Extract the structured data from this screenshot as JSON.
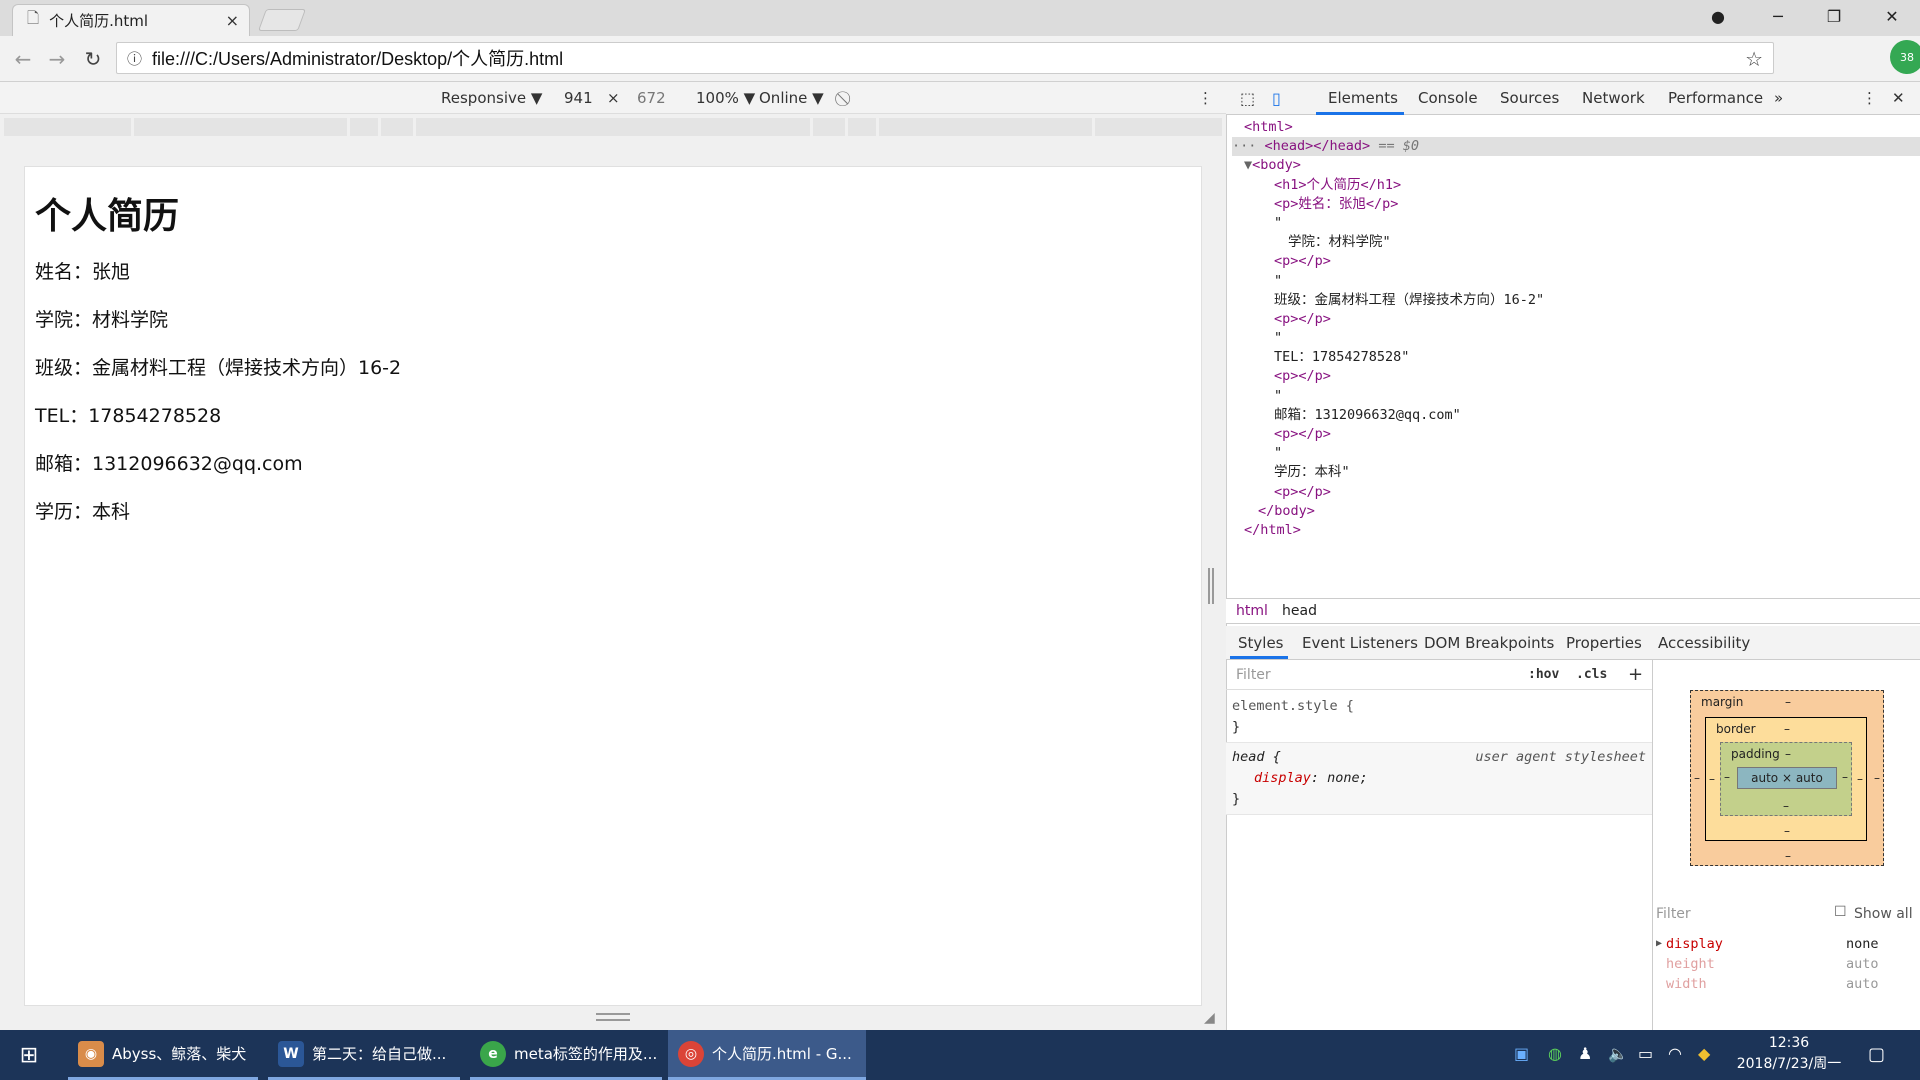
{
  "browser": {
    "tab_title": "个人简历.html",
    "tab_close": "×",
    "url": "file:///C:/Users/Administrator/Desktop/个人简历.html"
  },
  "device_toolbar": {
    "mode": "Responsive ▼",
    "width": "941",
    "times": "×",
    "height": "672",
    "zoom": "100% ▼",
    "network": "Online ▼"
  },
  "page": {
    "heading": "个人简历",
    "lines": [
      "姓名：张旭",
      "学院：材料学院",
      "班级：金属材料工程（焊接技术方向）16-2",
      "TEL：17854278528",
      "邮箱：1312096632@qq.com",
      "学历：本科"
    ]
  },
  "devtools": {
    "tabs": [
      "Elements",
      "Console",
      "Sources",
      "Network",
      "Performance",
      "»"
    ],
    "dom": {
      "html_open": "<html>",
      "head": "<head></head>",
      "head_marker": "== $0",
      "body_open": "<body>",
      "h1": "<h1>个人简历</h1>",
      "p1": "<p>姓名：张旭</p>",
      "q1": "\"",
      "t1": "学院：材料学院\"",
      "pe1": "<p></p>",
      "q2": "\"",
      "t2": "班级：金属材料工程（焊接技术方向）16-2\"",
      "pe2": "<p></p>",
      "q3": "\"",
      "t3": "TEL：17854278528\"",
      "pe3": "<p></p>",
      "q4": "\"",
      "t4": "邮箱：1312096632@qq.com\"",
      "pe4": "<p></p>",
      "q5": "\"",
      "t5": "学历：本科\"",
      "pe5": "<p></p>",
      "body_close": "</body>",
      "html_close": "</html>"
    },
    "breadcrumbs": [
      "html",
      "head"
    ],
    "style_tabs": [
      "Styles",
      "Event Listeners",
      "DOM Breakpoints",
      "Properties",
      "Accessibility"
    ],
    "filter_placeholder": "Filter",
    "hov": ":hov",
    "cls": ".cls",
    "plus": "+",
    "rules": {
      "element_style": "element.style {",
      "close": "}",
      "head_selector": "head {",
      "source": "user agent stylesheet",
      "decl_prop": "display",
      "decl_val": ": none;"
    },
    "box_model": {
      "margin": "margin",
      "border": "border",
      "padding": "padding",
      "dash": "–",
      "content": "auto × auto"
    },
    "computed_filter": "Filter",
    "show_all": "Show all",
    "computed": [
      {
        "prop": "display",
        "val": "none"
      },
      {
        "prop": "height",
        "val": "auto"
      },
      {
        "prop": "width",
        "val": "auto"
      }
    ]
  },
  "taskbar": {
    "items": [
      "Abyss、鲸落、柴犬",
      "第二天：给自己做...",
      "meta标签的作用及...",
      "个人简历.html - G..."
    ],
    "time": "12:36",
    "date": "2018/7/23/周一"
  },
  "colors": {
    "taskbar": "#1c3458",
    "accent": "#1a73e8",
    "tag": "#881280"
  }
}
